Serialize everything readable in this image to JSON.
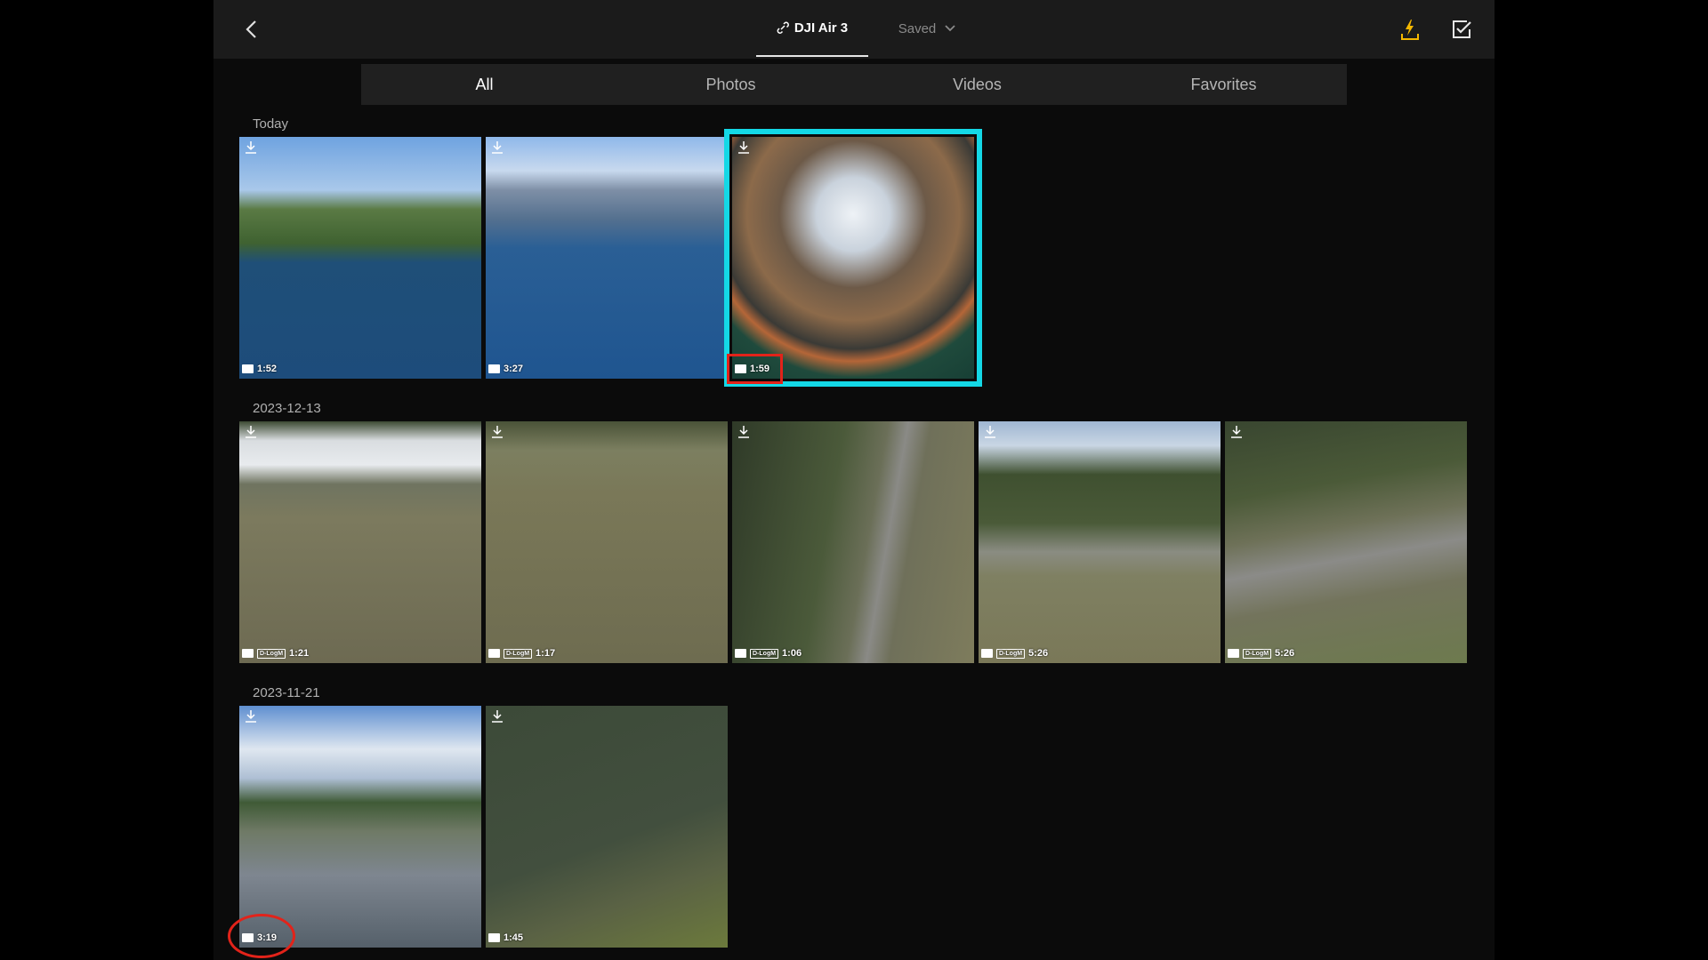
{
  "topbar": {
    "device_name": "DJI Air 3",
    "saved_label": "Saved"
  },
  "filters": [
    "All",
    "Photos",
    "Videos",
    "Favorites"
  ],
  "sections": [
    {
      "label": "Today",
      "items": [
        {
          "duration": "1:52",
          "type": "video",
          "dlog": false
        },
        {
          "duration": "3:27",
          "type": "video",
          "dlog": false
        },
        {
          "duration": "1:59",
          "type": "video",
          "dlog": false,
          "selected": true
        }
      ]
    },
    {
      "label": "2023-12-13",
      "items": [
        {
          "duration": "1:21",
          "type": "video",
          "dlog": true
        },
        {
          "duration": "1:17",
          "type": "video",
          "dlog": true
        },
        {
          "duration": "1:06",
          "type": "video",
          "dlog": true
        },
        {
          "duration": "5:26",
          "type": "video",
          "dlog": true
        },
        {
          "duration": "5:26",
          "type": "video",
          "dlog": true
        }
      ]
    },
    {
      "label": "2023-11-21",
      "items": [
        {
          "duration": "3:19",
          "type": "video",
          "dlog": false
        },
        {
          "duration": "1:45",
          "type": "video",
          "dlog": false
        }
      ]
    }
  ],
  "dlog_tag": "D-LogM",
  "colors": {
    "selection": "#14d8e6",
    "annotation": "#e2231a",
    "flash_icon": "#f5b800"
  }
}
